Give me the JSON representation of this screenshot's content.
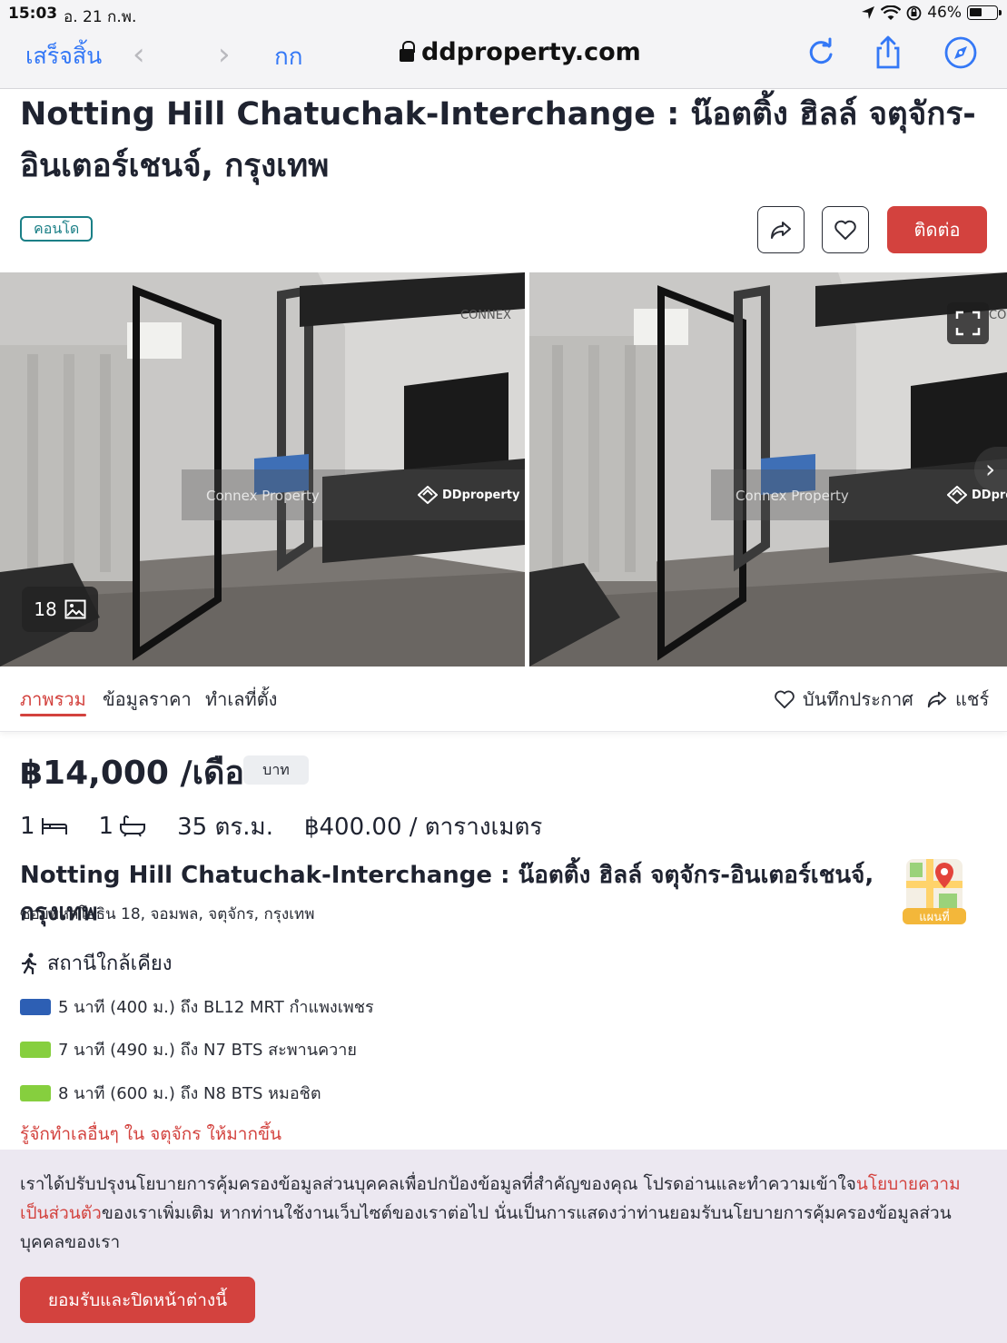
{
  "status_bar": {
    "time": "15:03",
    "date": "อ. 21 ก.พ.",
    "battery": "46%"
  },
  "browser": {
    "done_label": "เสร็จสิ้น",
    "text_size_label": "กก",
    "url": "ddproperty.com"
  },
  "listing": {
    "title": "Notting Hill Chatuchak-Interchange : น๊อตติ้ง ฮิลล์ จตุจักร-อินเตอร์เชนจ์, กรุงเทพ",
    "property_type_tag": "คอนโด",
    "contact_label": "ติดต่อ",
    "photo_count": "18",
    "photo_watermark": "Connex Property",
    "photo_brand": "DDproperty",
    "photo_brand_short": "DDpro",
    "photo_logo_text": "CONNEX",
    "photo_logo_text_short": "CO"
  },
  "tabs": {
    "items": [
      {
        "label": "ภาพรวม",
        "active": true
      },
      {
        "label": "ข้อมูลราคา",
        "active": false
      },
      {
        "label": "ทำเลที่ตั้ง",
        "active": false
      }
    ],
    "save_label": "บันทึกประกาศ",
    "share_label": "แชร์"
  },
  "price": {
    "amount": "฿14,000 /เดือน",
    "currency_pill": "บาท"
  },
  "specs": {
    "bedrooms": "1",
    "bathrooms": "1",
    "area": "35 ตร.ม.",
    "price_per_sqm": "฿400.00 / ตารางเมตร"
  },
  "project": {
    "name": "Notting Hill Chatuchak-Interchange : น๊อตติ้ง ฮิลล์ จตุจักร-อินเตอร์เชนจ์, กรุงเทพ",
    "address": "ซอยพหลโยธิน 18, จอมพล, จตุจักร, กรุงเทพ",
    "map_label": "แผนที่"
  },
  "nearby": {
    "title": "สถานีใกล้เคียง",
    "stations": [
      {
        "text": "5 นาที (400 ม.) ถึง BL12 MRT กำแพงเพชร",
        "color": "#2d5fb4"
      },
      {
        "text": "7 นาที (490 ม.) ถึง N7 BTS สะพานควาย",
        "color": "#86cf3e"
      },
      {
        "text": "8 นาที (600 ม.) ถึง N8 BTS หมอชิต",
        "color": "#86cf3e"
      }
    ],
    "more_link": "รู้จักทำเลอื่นๆ ใน จตุจักร ให้มากขึ้น"
  },
  "consent": {
    "text_before": "เราได้ปรับปรุงนโยบายการคุ้มครองข้อมูลส่วนบุคคลเพื่อปกป้องข้อมูลที่สำคัญของคุณ โปรดอ่านและทำความเข้าใจ",
    "link": "นโยบายความเป็นส่วนตัว",
    "text_after": "ของเราเพิ่มเติม หากท่านใช้งานเว็บไซต์ของเราต่อไป นั่นเป็นการแสดงว่าท่านยอมรับนโยบายการคุ้มครองข้อมูลส่วนบุคคลของเรา",
    "accept_label": "ยอมรับและปิดหน้าต่างนี้"
  },
  "colors": {
    "accent": "#d3423e",
    "teal": "#1a7f86",
    "ios_blue": "#3478f6"
  }
}
